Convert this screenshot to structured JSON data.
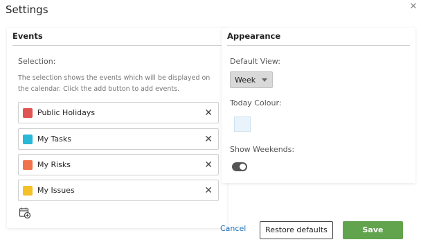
{
  "dialog": {
    "title": "Settings",
    "close_icon": "close-icon"
  },
  "events": {
    "header": "Events",
    "selection_label": "Selection:",
    "description": "The selection shows the events which will be displayed on the calendar. Click the add button to add events.",
    "items": [
      {
        "label": "Public Holidays",
        "color": "#e05452"
      },
      {
        "label": "My Tasks",
        "color": "#29b8d6"
      },
      {
        "label": "My Risks",
        "color": "#f0734c"
      },
      {
        "label": "My Issues",
        "color": "#f5c12b"
      }
    ],
    "remove_icon": "close-icon",
    "add_icon": "calendar-add-icon"
  },
  "appearance": {
    "header": "Appearance",
    "default_view_label": "Default View:",
    "default_view_value": "Week",
    "today_colour_label": "Today Colour:",
    "today_colour_value": "#e8f3fb",
    "show_weekends_label": "Show Weekends:",
    "show_weekends_on": true
  },
  "footer": {
    "cancel": "Cancel",
    "restore": "Restore defaults",
    "save": "Save"
  }
}
